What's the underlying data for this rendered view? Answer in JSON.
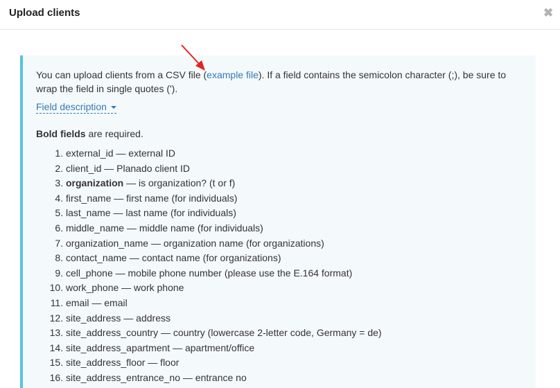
{
  "modal": {
    "title": "Upload clients",
    "close_icon": "close-icon"
  },
  "info": {
    "intro_before": "You can upload clients from a CSV file (",
    "example_link": "example file",
    "intro_after": "). If a field contains the semicolon character (;), be sure to wrap the field in single quotes (').",
    "field_description": "Field description",
    "bold_part": "Bold fields",
    "required_rest": " are required."
  },
  "fields": [
    {
      "name": "external_id",
      "desc": " — external ID",
      "bold": false
    },
    {
      "name": "client_id",
      "desc": " — Planado client ID",
      "bold": false
    },
    {
      "name": "organization",
      "desc": " — is organization? (t or f)",
      "bold": true
    },
    {
      "name": "first_name",
      "desc": " — first name (for individuals)",
      "bold": false
    },
    {
      "name": "last_name",
      "desc": " — last name (for individuals)",
      "bold": false
    },
    {
      "name": "middle_name",
      "desc": " — middle name (for individuals)",
      "bold": false
    },
    {
      "name": "organization_name",
      "desc": " — organization name (for organizations)",
      "bold": false
    },
    {
      "name": "contact_name",
      "desc": " — contact name (for organizations)",
      "bold": false
    },
    {
      "name": "cell_phone",
      "desc": " — mobile phone number (please use the E.164 format)",
      "bold": false
    },
    {
      "name": "work_phone",
      "desc": " — work phone",
      "bold": false
    },
    {
      "name": "email",
      "desc": " — email",
      "bold": false
    },
    {
      "name": "site_address",
      "desc": " — address",
      "bold": false
    },
    {
      "name": "site_address_country",
      "desc": " — country (lowercase 2-letter code, Germany = de)",
      "bold": false
    },
    {
      "name": "site_address_apartment",
      "desc": " — apartment/office",
      "bold": false
    },
    {
      "name": "site_address_floor",
      "desc": " — floor",
      "bold": false
    },
    {
      "name": "site_address_entrance_no",
      "desc": " — entrance no",
      "bold": false
    }
  ],
  "colors": {
    "accent": "#5bc0de",
    "link": "#337ab7",
    "box_bg": "#f4f9fb",
    "annotation_arrow": "#e32222"
  }
}
